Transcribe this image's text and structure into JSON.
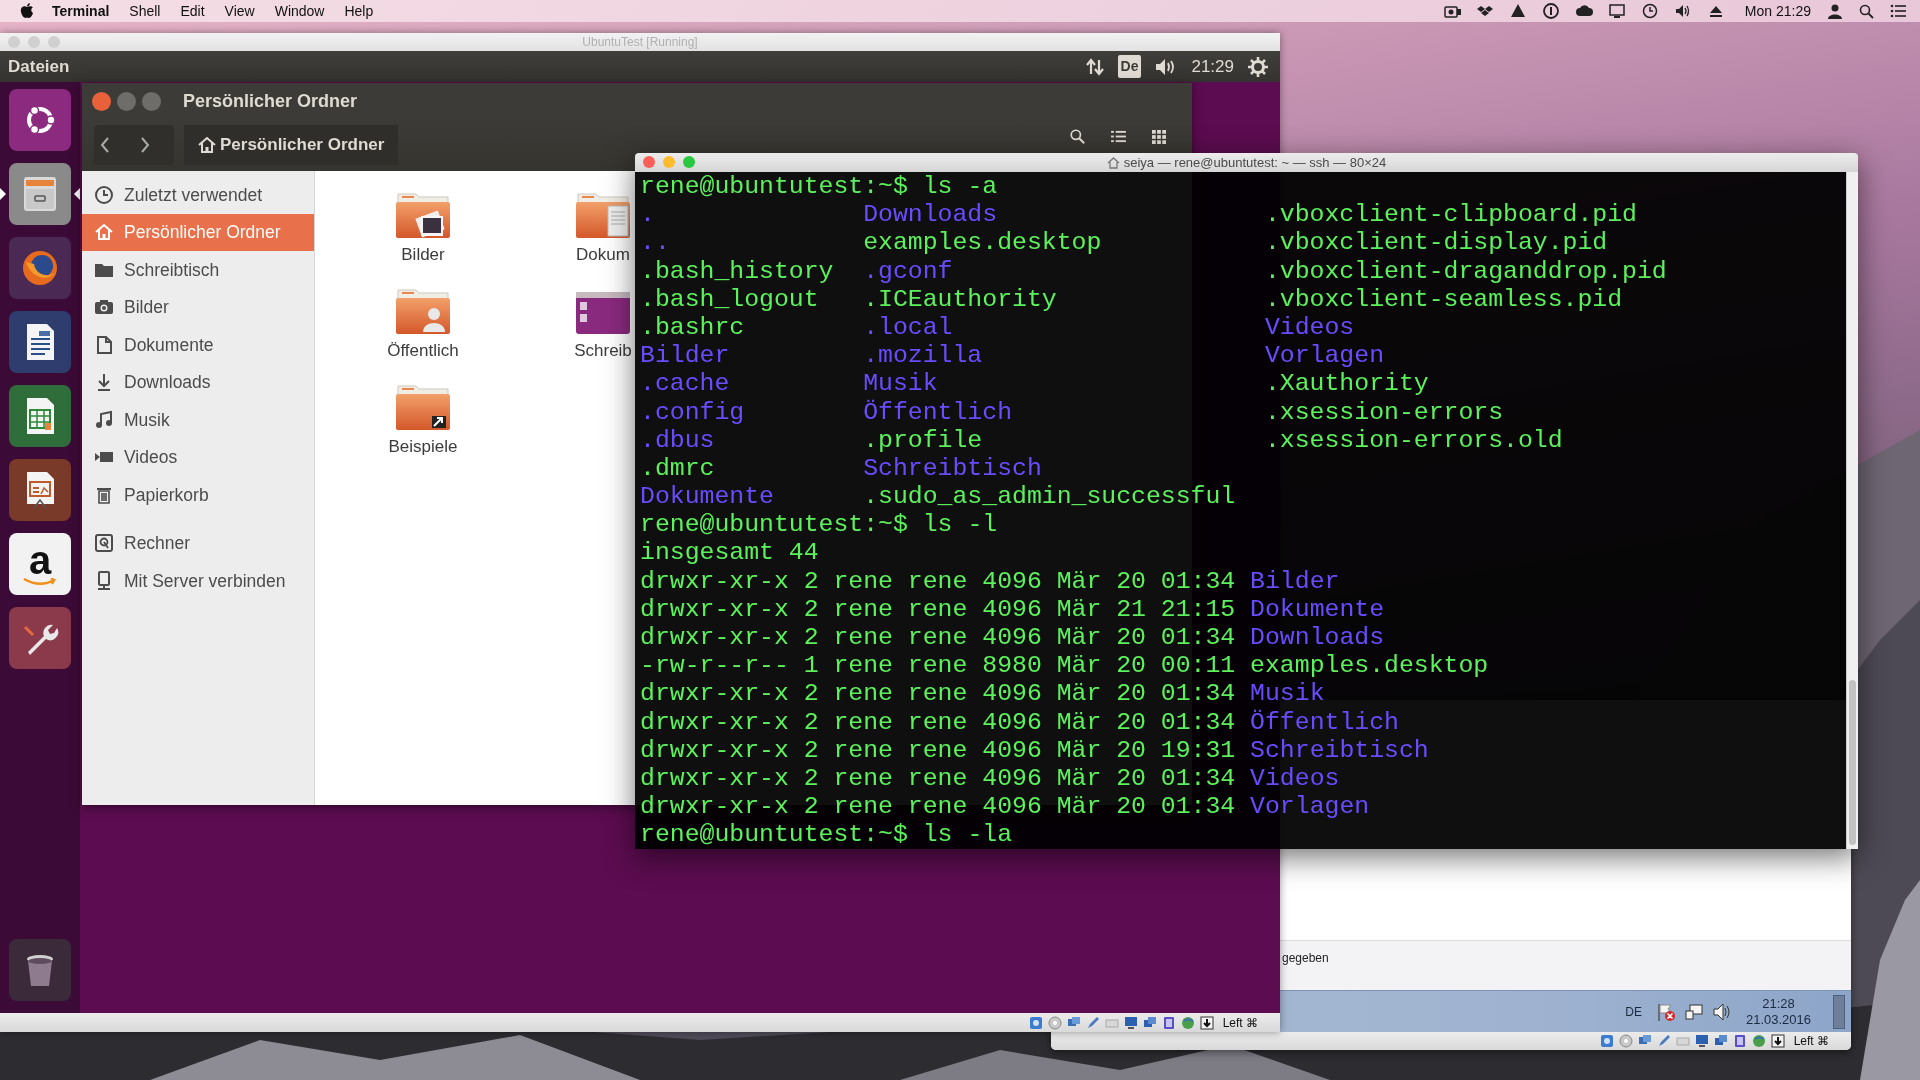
{
  "menu_bar": {
    "app": "Terminal",
    "items": [
      "Shell",
      "Edit",
      "View",
      "Window",
      "Help"
    ],
    "clock": "Mon 21:29"
  },
  "vm_window": {
    "title": "UbuntuTest [Running]",
    "status_bar": {
      "host_key": "Left ⌘"
    }
  },
  "ubuntu_panel": {
    "app": "Dateien",
    "keyboard": "De",
    "clock": "21:29"
  },
  "launcher": [
    {
      "kind": "dash",
      "focused": false
    },
    {
      "kind": "files",
      "focused": true
    },
    {
      "kind": "browser",
      "focused": false
    },
    {
      "kind": "writer",
      "focused": false
    },
    {
      "kind": "calc",
      "focused": false
    },
    {
      "kind": "impress",
      "focused": false
    },
    {
      "kind": "shop",
      "glyph": "a",
      "focused": false
    },
    {
      "kind": "settings",
      "focused": false
    },
    {
      "kind": "trash",
      "focused": false
    }
  ],
  "file_manager": {
    "title": "Persönlicher Ordner",
    "path": "Persönlicher Ordner",
    "sidebar_groups": [
      {
        "items": [
          {
            "label": "Zuletzt verwendet",
            "kind": "recent",
            "selected": false
          },
          {
            "label": "Persönlicher Ordner",
            "kind": "home",
            "selected": true
          },
          {
            "label": "Schreibtisch",
            "kind": "desktop",
            "selected": false
          },
          {
            "label": "Bilder",
            "kind": "pictures",
            "selected": false
          },
          {
            "label": "Dokumente",
            "kind": "documents",
            "selected": false
          },
          {
            "label": "Downloads",
            "kind": "downloads",
            "selected": false
          },
          {
            "label": "Musik",
            "kind": "music",
            "selected": false
          },
          {
            "label": "Videos",
            "kind": "videos",
            "selected": false
          },
          {
            "label": "Papierkorb",
            "kind": "trash",
            "selected": false
          }
        ]
      },
      {
        "items": [
          {
            "label": "Rechner",
            "kind": "computer",
            "selected": false
          },
          {
            "label": "Mit Server verbinden",
            "kind": "network",
            "selected": false
          }
        ]
      }
    ],
    "items": [
      {
        "label": "Bilder",
        "kind": "pictures"
      },
      {
        "label": "Dokum",
        "kind": "documents"
      },
      {
        "label": "Öffentlich",
        "kind": "public"
      },
      {
        "label": "Schreib",
        "kind": "desktop"
      },
      {
        "label": "Beispiele",
        "kind": "examples"
      }
    ]
  },
  "terminal": {
    "title": "seiya — rene@ubuntutest: ~ — ssh — 80×24",
    "lines": [
      {
        "kind": "prompt",
        "prompt": "rene@ubuntutest:~$",
        "command": "ls -a"
      },
      {
        "kind": "columns",
        "cells": [
          {
            "text": ".",
            "kind": "dir"
          },
          {
            "text": "Downloads",
            "kind": "dir"
          },
          {
            "text": ".vboxclient-clipboard.pid",
            "kind": "file"
          }
        ]
      },
      {
        "kind": "columns",
        "cells": [
          {
            "text": "..",
            "kind": "dir"
          },
          {
            "text": "examples.desktop",
            "kind": "file"
          },
          {
            "text": ".vboxclient-display.pid",
            "kind": "file"
          }
        ]
      },
      {
        "kind": "columns",
        "cells": [
          {
            "text": ".bash_history",
            "kind": "file"
          },
          {
            "text": ".gconf",
            "kind": "dir"
          },
          {
            "text": ".vboxclient-draganddrop.pid",
            "kind": "file"
          }
        ]
      },
      {
        "kind": "columns",
        "cells": [
          {
            "text": ".bash_logout",
            "kind": "file"
          },
          {
            "text": ".ICEauthority",
            "kind": "file"
          },
          {
            "text": ".vboxclient-seamless.pid",
            "kind": "file"
          }
        ]
      },
      {
        "kind": "columns",
        "cells": [
          {
            "text": ".bashrc",
            "kind": "file"
          },
          {
            "text": ".local",
            "kind": "dir"
          },
          {
            "text": "Videos",
            "kind": "dir"
          }
        ]
      },
      {
        "kind": "columns",
        "cells": [
          {
            "text": "Bilder",
            "kind": "dir"
          },
          {
            "text": ".mozilla",
            "kind": "dir"
          },
          {
            "text": "Vorlagen",
            "kind": "dir"
          }
        ]
      },
      {
        "kind": "columns",
        "cells": [
          {
            "text": ".cache",
            "kind": "dir"
          },
          {
            "text": "Musik",
            "kind": "dir"
          },
          {
            "text": ".Xauthority",
            "kind": "file"
          }
        ]
      },
      {
        "kind": "columns",
        "cells": [
          {
            "text": ".config",
            "kind": "dir"
          },
          {
            "text": "Öffentlich",
            "kind": "dir"
          },
          {
            "text": ".xsession-errors",
            "kind": "file"
          }
        ]
      },
      {
        "kind": "columns",
        "cells": [
          {
            "text": ".dbus",
            "kind": "dir"
          },
          {
            "text": ".profile",
            "kind": "file"
          },
          {
            "text": ".xsession-errors.old",
            "kind": "file"
          }
        ]
      },
      {
        "kind": "columns",
        "cells": [
          {
            "text": ".dmrc",
            "kind": "file"
          },
          {
            "text": "Schreibtisch",
            "kind": "dir"
          }
        ]
      },
      {
        "kind": "columns",
        "cells": [
          {
            "text": "Dokumente",
            "kind": "dir"
          },
          {
            "text": ".sudo_as_admin_successful",
            "kind": "file"
          }
        ]
      },
      {
        "kind": "prompt",
        "prompt": "rene@ubuntutest:~$",
        "command": "ls -l"
      },
      {
        "kind": "text",
        "text": "insgesamt 44"
      },
      {
        "kind": "listing",
        "details": "drwxr-xr-x 2 rene rene 4096 Mär 20 01:34",
        "entry": {
          "text": "Bilder",
          "kind": "dir"
        }
      },
      {
        "kind": "listing",
        "details": "drwxr-xr-x 2 rene rene 4096 Mär 21 21:15",
        "entry": {
          "text": "Dokumente",
          "kind": "dir"
        }
      },
      {
        "kind": "listing",
        "details": "drwxr-xr-x 2 rene rene 4096 Mär 20 01:34",
        "entry": {
          "text": "Downloads",
          "kind": "dir"
        }
      },
      {
        "kind": "listing",
        "details": "-rw-r--r-- 1 rene rene 8980 Mär 20 00:11",
        "entry": {
          "text": "examples.desktop",
          "kind": "file"
        }
      },
      {
        "kind": "listing",
        "details": "drwxr-xr-x 2 rene rene 4096 Mär 20 01:34",
        "entry": {
          "text": "Musik",
          "kind": "dir"
        }
      },
      {
        "kind": "listing",
        "details": "drwxr-xr-x 2 rene rene 4096 Mär 20 01:34",
        "entry": {
          "text": "Öffentlich",
          "kind": "dir"
        }
      },
      {
        "kind": "listing",
        "details": "drwxr-xr-x 2 rene rene 4096 Mär 20 19:31",
        "entry": {
          "text": "Schreibtisch",
          "kind": "dir"
        }
      },
      {
        "kind": "listing",
        "details": "drwxr-xr-x 2 rene rene 4096 Mär 20 01:34",
        "entry": {
          "text": "Videos",
          "kind": "dir"
        }
      },
      {
        "kind": "listing",
        "details": "drwxr-xr-x 2 rene rene 4096 Mär 20 01:34",
        "entry": {
          "text": "Vorlagen",
          "kind": "dir"
        }
      },
      {
        "kind": "prompt",
        "prompt": "rene@ubuntutest:~$",
        "command": "ls -la"
      }
    ]
  },
  "second_vm": {
    "text": "gegeben",
    "keyboard": "DE",
    "time": "21:28",
    "date": "21.03.2016",
    "status_bar": {
      "host_key": "Left ⌘"
    }
  }
}
